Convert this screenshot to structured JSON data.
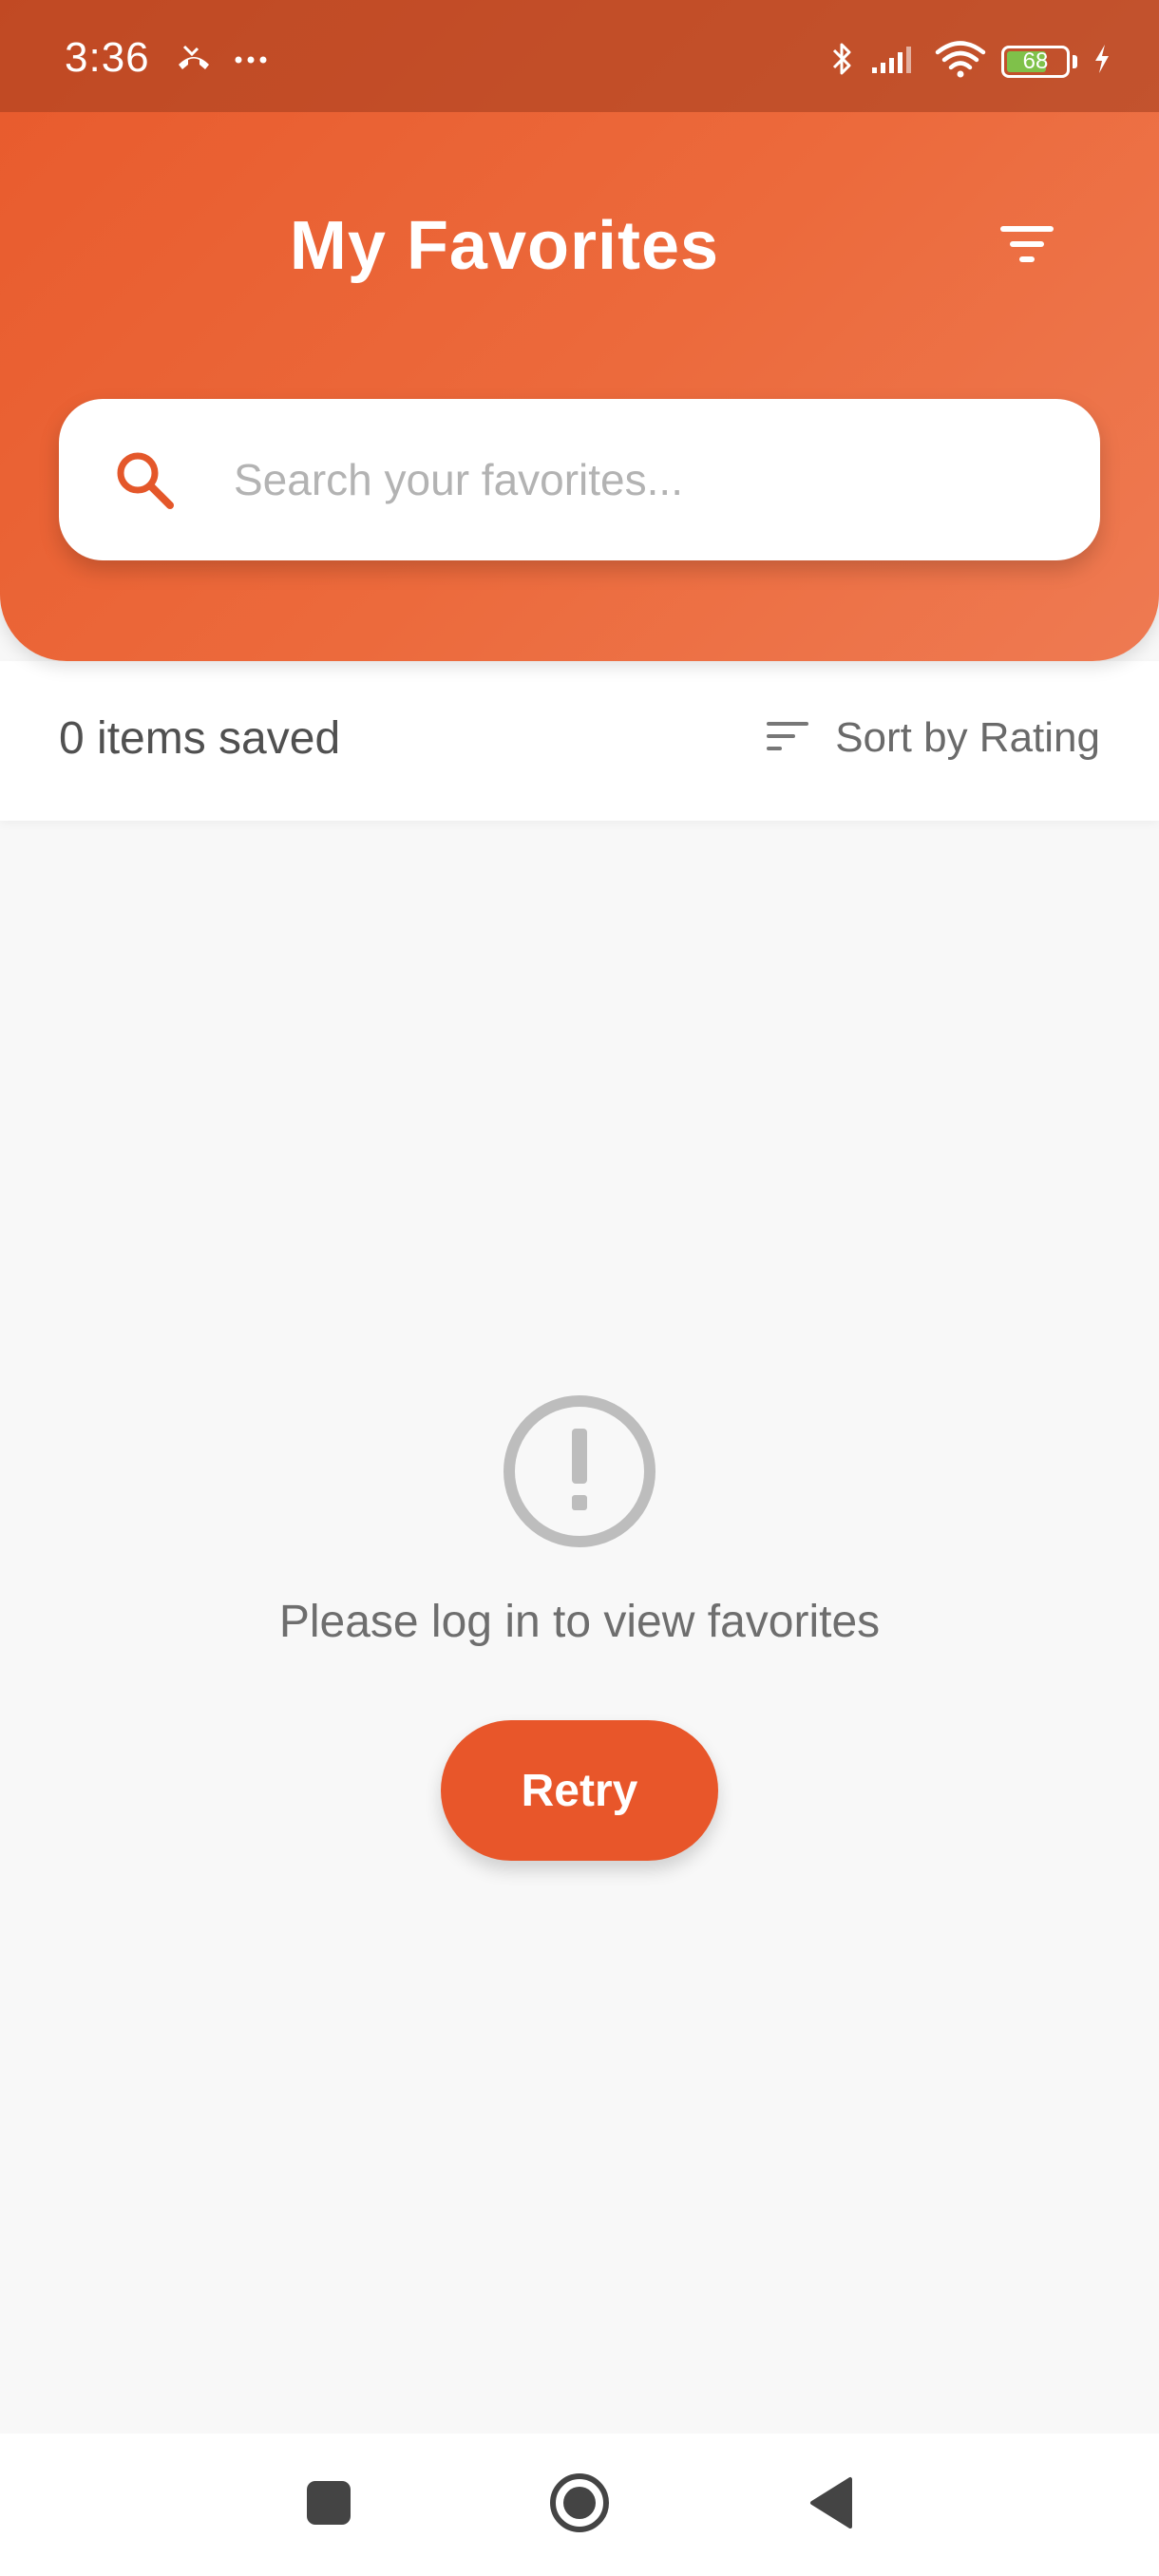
{
  "status_bar": {
    "time": "3:36",
    "notification_icons": [
      "missed-call-icon",
      "more-dots-icon"
    ],
    "system_icons": [
      "bluetooth-icon",
      "signal-icon",
      "wifi-icon",
      "battery-icon",
      "charging-icon"
    ],
    "battery_level": "68",
    "battery_fraction": 0.68
  },
  "header": {
    "title": "My Favorites",
    "filter_icon": "filter-icon"
  },
  "search": {
    "placeholder": "Search your favorites...",
    "value": "",
    "icon": "search-icon"
  },
  "info_bar": {
    "count_text": "0 items saved",
    "sort_label": "Sort by Rating",
    "sort_icon": "sort-icon"
  },
  "empty_state": {
    "icon": "alert-circle-icon",
    "message": "Please log in to view favorites",
    "retry_label": "Retry"
  },
  "nav_bar": {
    "buttons": [
      "recents-square-icon",
      "home-circle-icon",
      "back-triangle-icon"
    ]
  },
  "colors": {
    "accent": "#e8562a",
    "header_gradient_start": "#e85a2c",
    "header_gradient_end": "#ee7a52",
    "background": "#f8f8f8",
    "muted_icon": "#bdbdbd"
  }
}
